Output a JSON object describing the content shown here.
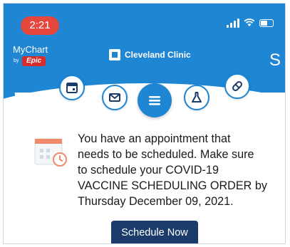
{
  "status_bar": {
    "time": "2:21"
  },
  "header": {
    "mychart_logo": "MyChart",
    "mychart_by": "by",
    "epic_logo": "Epic",
    "clinic_name": "Cleveland Clinic",
    "user_initial": "S"
  },
  "nav": {
    "icons": [
      "calendar-icon",
      "mail-icon",
      "menu-icon",
      "flask-icon",
      "pill-icon"
    ]
  },
  "appointment": {
    "message": "You have an appointment that\nneeds to be scheduled. Make sure\nto schedule your COVID-19\nVACCINE SCHEDULING ORDER by\nThursday December 09, 2021.",
    "button_label": "Schedule Now"
  },
  "colors": {
    "brand_blue": "#1e86d3",
    "button_navy": "#1b3c6a",
    "time_pill_red": "#e5473c",
    "epic_red": "#d62c2c",
    "calendar_accent": "#f08a6a"
  }
}
